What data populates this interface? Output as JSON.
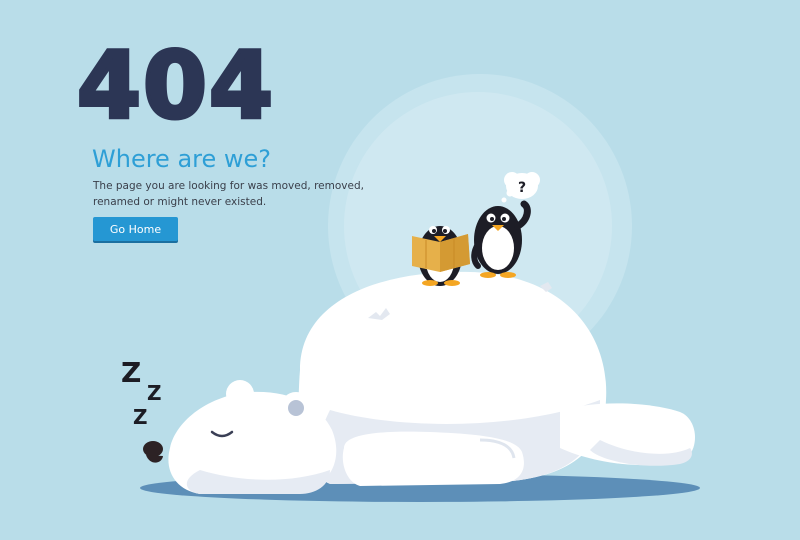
{
  "error": {
    "code": "404",
    "headline": "Where are we?",
    "description": "The page you are looking for was moved, removed, renamed or might never existed."
  },
  "actions": {
    "home_label": "Go Home"
  },
  "illustration": {
    "thought_symbol": "?",
    "sleep_letters": [
      "Z",
      "Z",
      "Z"
    ]
  },
  "colors": {
    "background": "#b9dde9",
    "code_text": "#2c3655",
    "headline": "#2e9fd6",
    "button": "#2597d3"
  }
}
